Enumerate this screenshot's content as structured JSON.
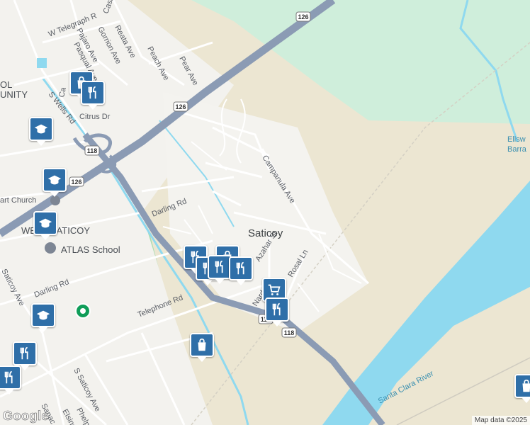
{
  "map": {
    "place_label": "Saticoy",
    "neighborhood_label": "WEST SATICOY",
    "neighborhood_label_partial": "OL\nUNITY",
    "school_label": "ATLAS School",
    "church_label": "art Church",
    "water_label": "Santa Clara River",
    "barranca_label_1": "Ellsw",
    "barranca_label_2": "Barra",
    "streets": {
      "telegraph": "W Telegraph R",
      "casa": "Casa St",
      "pajaro": "Pajaro Ave",
      "gorrion": "Gorrion Ave",
      "reata": "Reata Ave",
      "pasqual": "Pasqual Ave",
      "peach": "Peach Ave",
      "pear": "Pear Ave",
      "wells": "S Wells Rd",
      "citrus": "Citrus Dr",
      "campanula": "Campanula Ave",
      "darling": "Darling Rd",
      "azahar": "Azahar St",
      "nardo": "Nardo",
      "rosal": "Rosal Ln",
      "telephone": "Telephone Rd",
      "darling2": "Darling Rd",
      "saticoy_ave": "Saticoy Ave",
      "s_saticoy_ave": "S Saticoy Ave",
      "phelps": "Phelps Ave",
      "elsinore": "Elsinore",
      "sanac": "Sanac St",
      "ca_partial": "Ca"
    },
    "shields": [
      "126",
      "126",
      "118",
      "126",
      "118",
      "118"
    ],
    "pins": [
      "shopping-bag-icon",
      "restaurant-icon",
      "school-icon",
      "school-icon",
      "school-icon",
      "restaurant-icon",
      "restaurant-icon",
      "restaurant-icon",
      "restaurant-icon",
      "grocery-cart-icon",
      "restaurant-icon",
      "shopping-bag-icon",
      "school-icon",
      "restaurant-icon",
      "restaurant-icon",
      "shopping-bag-icon"
    ],
    "colors": {
      "background": "#f2f1ed",
      "green": "#c9ecd3",
      "park": "#a8dcae",
      "sand": "#e9e3cf",
      "water": "#8fd9ef",
      "highway": "#8b9bb4",
      "pin": "#2f6fa8"
    }
  },
  "logo": "Google",
  "attribution": "Map data ©2025"
}
